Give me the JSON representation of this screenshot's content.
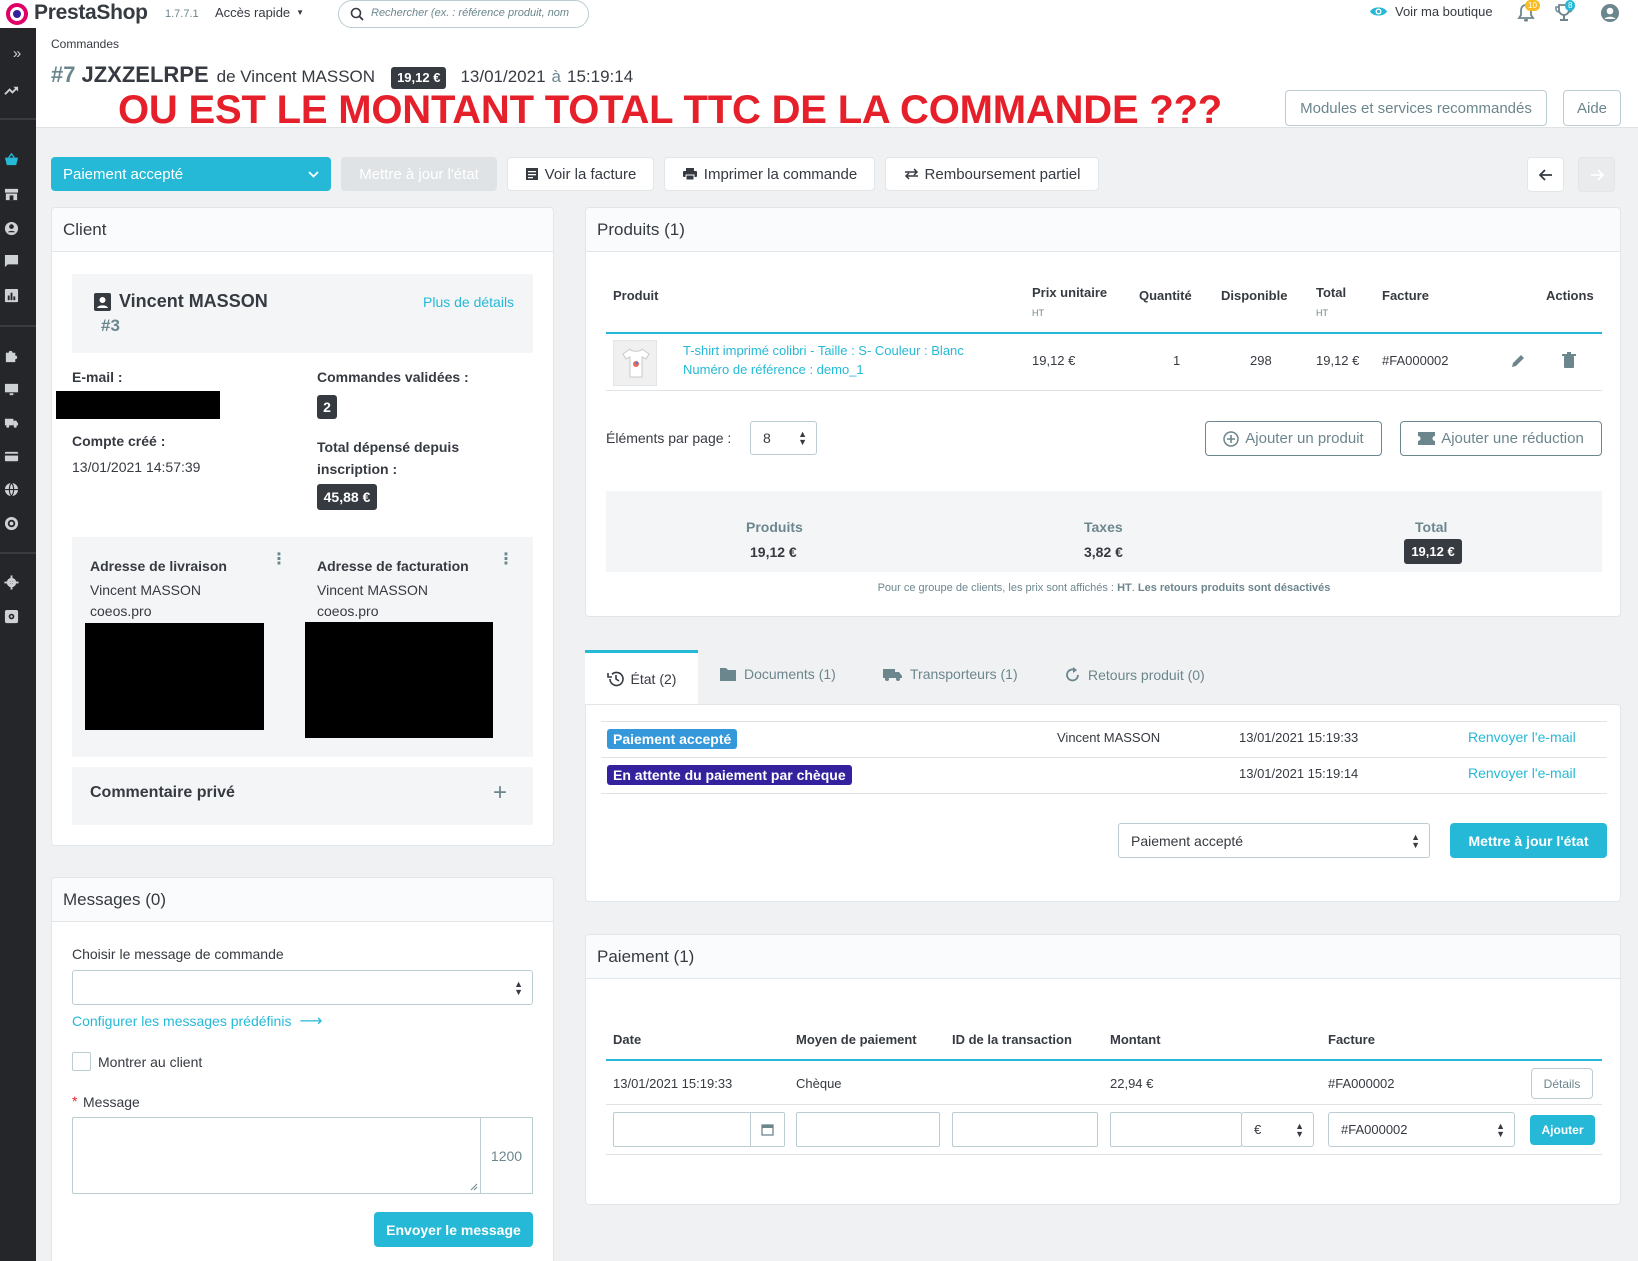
{
  "app": {
    "name": "PrestaShop",
    "version": "1.7.7.1",
    "quick_access": "Accès rapide",
    "search_placeholder": "Rechercher (ex. : référence produit, nom",
    "view_shop": "Voir ma boutique",
    "notif_count": "10",
    "trophy_count": "8"
  },
  "breadcrumb": "Commandes",
  "order": {
    "number": "#7",
    "reference": "JZXZELRPE",
    "by": "de Vincent MASSON",
    "amount": "19,12 €",
    "date": "13/01/2021",
    "at": "à",
    "time": "15:19:14"
  },
  "annotation": "OU EST LE MONTANT TOTAL TTC DE LA COMMANDE ???",
  "header_buttons": {
    "modules": "Modules et services recommandés",
    "help": "Aide"
  },
  "toolbar": {
    "status": "Paiement accepté",
    "update_state": "Mettre à jour l'état",
    "view_invoice": "Voir la facture",
    "print": "Imprimer la commande",
    "refund": "Remboursement partiel"
  },
  "client": {
    "title": "Client",
    "name": "Vincent MASSON",
    "id": "#3",
    "more": "Plus de détails",
    "email_label": "E-mail :",
    "orders_label": "Commandes validées :",
    "orders_count": "2",
    "created_label": "Compte créé :",
    "created_value": "13/01/2021 14:57:39",
    "spent_label_1": "Total dépensé depuis",
    "spent_label_2": "inscription :",
    "spent_value": "45,88 €",
    "shipping_title": "Adresse de livraison",
    "shipping_name": "Vincent MASSON",
    "shipping_company": "coeos.pro",
    "billing_title": "Adresse de facturation",
    "billing_name": "Vincent MASSON",
    "billing_company": "coeos.pro",
    "private_comment": "Commentaire privé"
  },
  "messages": {
    "title": "Messages (0)",
    "choose_label": "Choisir le message de commande",
    "configure": "Configurer les messages prédéfinis",
    "show_client": "Montrer au client",
    "required": "*",
    "message_label": "Message",
    "counter": "1200",
    "send": "Envoyer le message"
  },
  "products": {
    "title": "Produits (1)",
    "headers": {
      "product": "Produit",
      "unit_price": "Prix unitaire",
      "ht": "HT",
      "qty": "Quantité",
      "available": "Disponible",
      "total": "Total",
      "invoice": "Facture",
      "actions": "Actions"
    },
    "row": {
      "name": "T-shirt imprimé colibri - Taille : S- Couleur : Blanc",
      "ref": "Numéro de référence : demo_1",
      "unit": "19,12 €",
      "qty": "1",
      "available": "298",
      "total": "19,12 €",
      "invoice": "#FA000002"
    },
    "per_page_label": "Éléments par page :",
    "per_page": "8",
    "add_product": "Ajouter un produit",
    "add_discount": "Ajouter une réduction",
    "summary": {
      "products_label": "Produits",
      "products_value": "19,12 €",
      "taxes_label": "Taxes",
      "taxes_value": "3,82 €",
      "total_label": "Total",
      "total_value": "19,12 €"
    },
    "note_prefix": "Pour ce groupe de clients, les prix sont affichés :",
    "note_ht": "HT",
    "note_bold": "Les retours produits sont désactivés"
  },
  "tabs": {
    "state": "État (2)",
    "documents": "Documents (1)",
    "carriers": "Transporteurs (1)",
    "returns": "Retours produit (0)"
  },
  "history": [
    {
      "status": "Paiement accepté",
      "color": "#3498db",
      "employee": "Vincent MASSON",
      "date": "13/01/2021 15:19:33",
      "resend": "Renvoyer l'e-mail"
    },
    {
      "status": "En attente du paiement par chèque",
      "color": "#4169e1",
      "employee": "",
      "date": "13/01/2021 15:19:14",
      "resend": "Renvoyer l'e-mail"
    }
  ],
  "state_select": "Paiement accepté",
  "state_update": "Mettre à jour l'état",
  "payment": {
    "title": "Paiement (1)",
    "headers": {
      "date": "Date",
      "method": "Moyen de paiement",
      "transaction": "ID de la transaction",
      "amount": "Montant",
      "invoice": "Facture"
    },
    "row": {
      "date": "13/01/2021 15:19:33",
      "method": "Chèque",
      "transaction": "",
      "amount": "22,94 €",
      "invoice": "#FA000002",
      "details": "Détails"
    },
    "currency": "€",
    "invoice_select": "#FA000002",
    "add": "Ajouter"
  }
}
